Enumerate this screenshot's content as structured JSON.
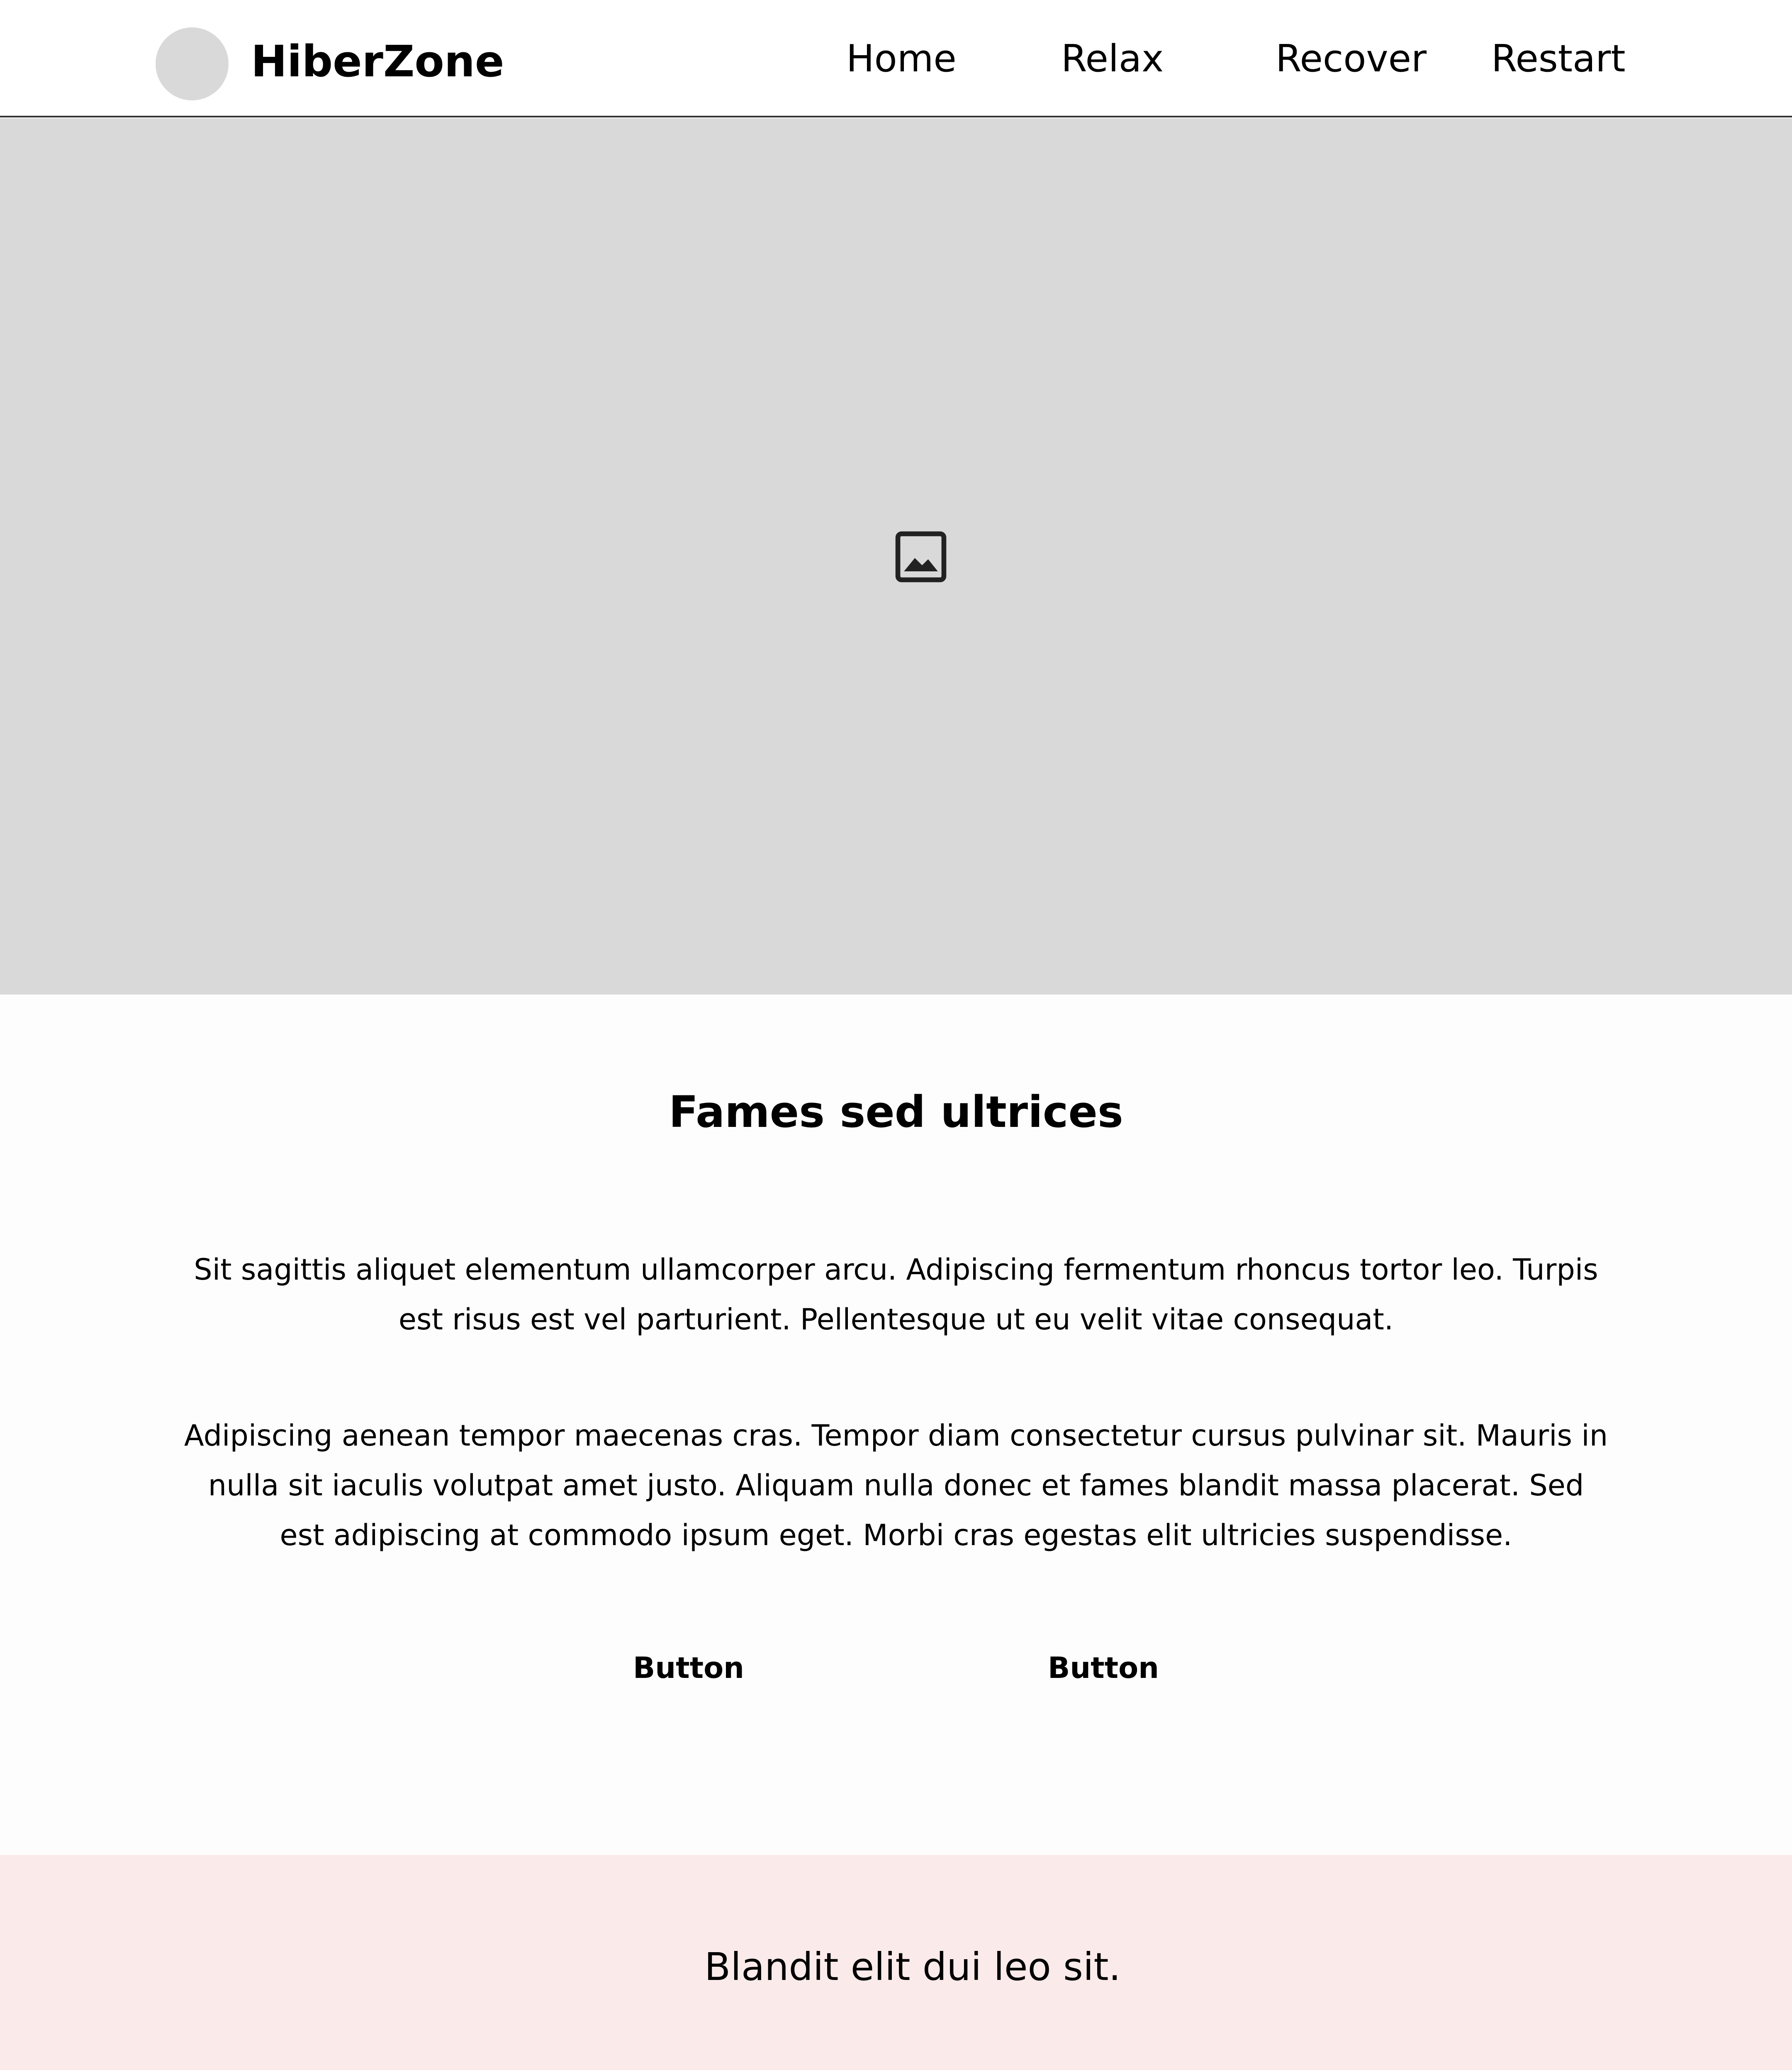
{
  "header": {
    "brand": "HiberZone",
    "nav": [
      {
        "label": "Home"
      },
      {
        "label": "Relax"
      },
      {
        "label": "Recover"
      },
      {
        "label": "Restart"
      }
    ]
  },
  "hero": {
    "icon": "image-placeholder-icon"
  },
  "content": {
    "title": "Fames sed ultrices",
    "paragraphs": [
      "Sit sagittis aliquet elementum ullamcorper arcu. Adipiscing fermentum rhoncus tortor leo. Turpis est risus est vel parturient. Pellentesque ut eu velit vitae consequat.",
      "Adipiscing aenean tempor maecenas cras. Tempor diam consectetur cursus pulvinar sit. Mauris in nulla sit iaculis volutpat amet justo. Aliquam nulla donec et fames blandit massa placerat. Sed est adipiscing at commodo ipsum eget. Morbi cras egestas elit ultricies suspendisse."
    ],
    "buttons": [
      {
        "label": "Button"
      },
      {
        "label": "Button"
      }
    ]
  },
  "footer": {
    "text": "Blandit elit dui leo sit."
  },
  "colors": {
    "placeholder_gray": "#d9d9d9",
    "footer_pink": "#fbeaea",
    "text": "#000000"
  }
}
